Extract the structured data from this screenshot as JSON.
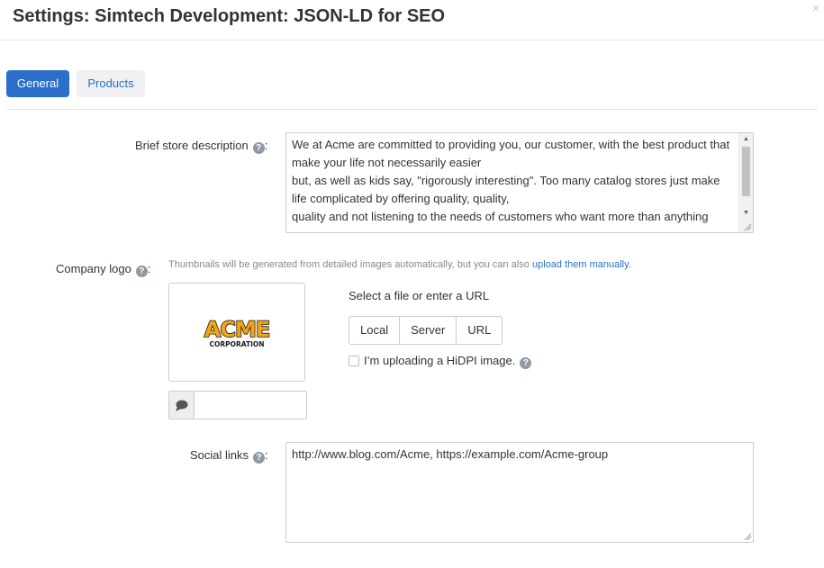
{
  "dialog": {
    "title": "Settings: Simtech Development: JSON-LD for SEO",
    "close_glyph": "×"
  },
  "tabs": [
    {
      "label": "General",
      "active": true
    },
    {
      "label": "Products",
      "active": false
    }
  ],
  "help_glyph": "?",
  "brief_description": {
    "label": "Brief store description",
    "label_suffix": ":",
    "lines": [
      "We at Acme are committed to providing you, our customer, with the best product that",
      "make your life not necessarily easier",
      "but, as well as kids say, \"rigorously interesting\". Too many catalog stores just make",
      "life complicated by offering quality, quality,",
      "quality and not listening to the needs of customers who want more than anything"
    ]
  },
  "company_logo": {
    "label": "Company logo",
    "label_suffix": ":",
    "hint_text": "Thumbnails will be generated from detailed images automatically, but you can also ",
    "hint_link": "upload them manually.",
    "logo_word": "ACME",
    "logo_sub": "CORPORATION",
    "alt_text_value": "",
    "alt_icon": "comment-icon",
    "select_label": "Select a file or enter a URL",
    "source_buttons": [
      "Local",
      "Server",
      "URL"
    ],
    "hidpi_label": "I’m uploading a HiDPI image.",
    "hidpi_checked": false
  },
  "social_links": {
    "label": "Social links",
    "label_suffix": ":",
    "value": "http://www.blog.com/Acme, https://example.com/Acme-group"
  },
  "colors": {
    "accent": "#2b6fc9",
    "tab_inactive_bg": "#eef0f3",
    "logo_orange": "#f3a411",
    "logo_dark": "#1a1a1a"
  }
}
